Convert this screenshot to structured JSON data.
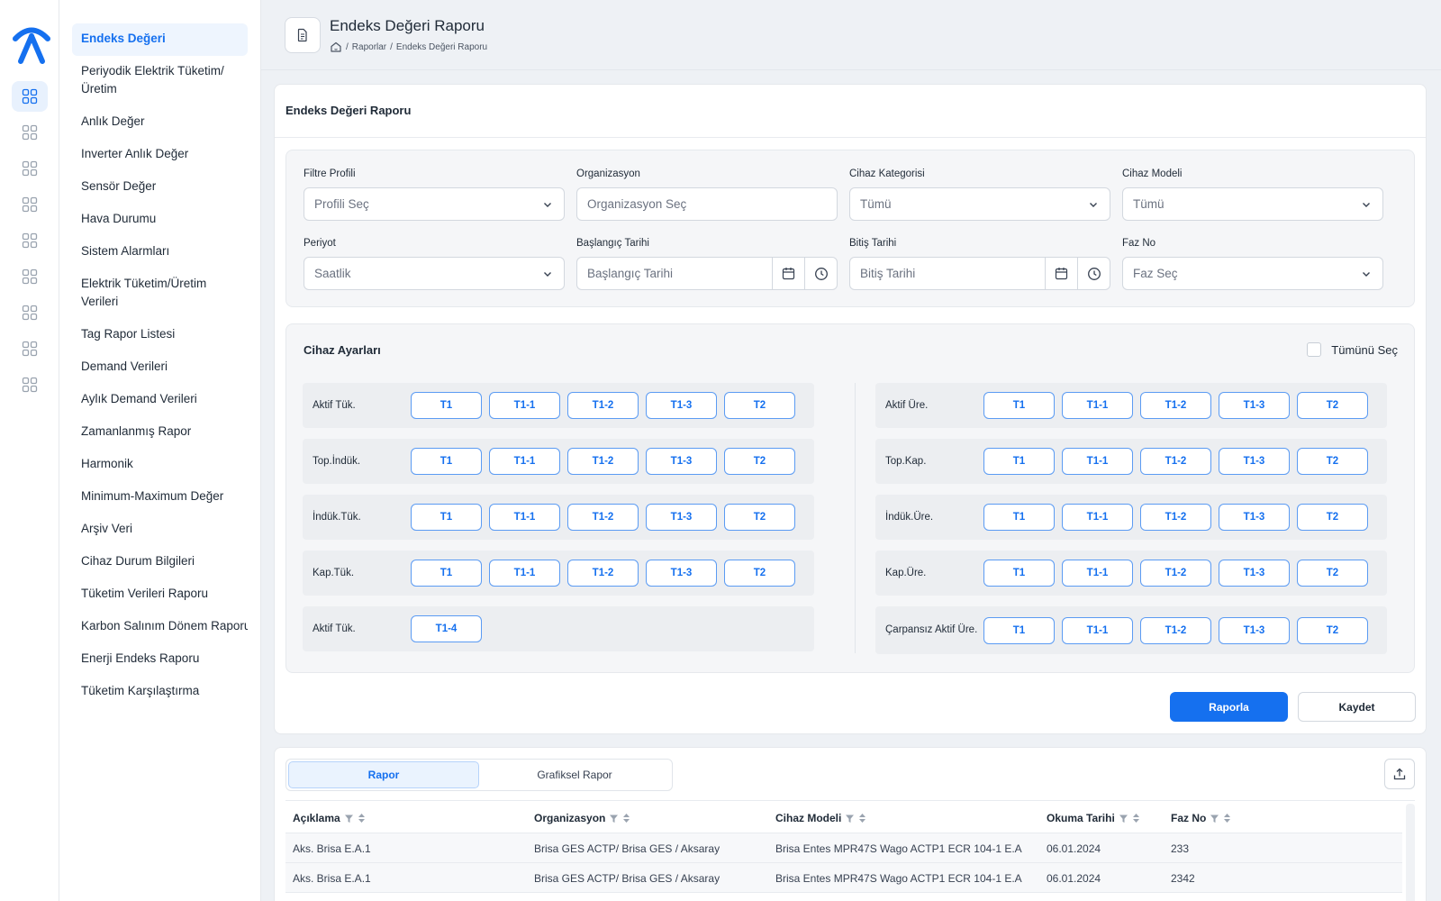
{
  "nav": {
    "items": [
      "Endeks Değeri",
      "Periyodik Elektrik Tüketim/ Üretim",
      "Anlık Değer",
      "Inverter Anlık Değer",
      "Sensör Değer",
      "Hava Durumu",
      "Sistem Alarmları",
      "Elektrik Tüketim/Üretim Verileri",
      "Tag Rapor Listesi",
      "Demand Verileri",
      "Aylık Demand Verileri",
      "Zamanlanmış Rapor",
      "Harmonik",
      "Minimum-Maximum Değer",
      "Arşiv Veri",
      "Cihaz Durum Bilgileri",
      "Tüketim Verileri Raporu",
      "Karbon Salınım Dönem Raporu",
      "Enerji Endeks Raporu",
      "Tüketim Karşılaştırma"
    ]
  },
  "header": {
    "title": "Endeks Değeri Raporu",
    "breadcrumb": [
      "Raporlar",
      "Endeks Değeri Raporu"
    ]
  },
  "form": {
    "card_title": "Endeks Değeri Raporu",
    "filtre_profili": {
      "label": "Filtre Profili",
      "value": "Profili Seç"
    },
    "organizasyon": {
      "label": "Organizasyon",
      "placeholder": "Organizasyon Seç"
    },
    "cihaz_kategorisi": {
      "label": "Cihaz Kategorisi",
      "value": "Tümü"
    },
    "cihaz_modeli": {
      "label": "Cihaz Modeli",
      "value": "Tümü"
    },
    "periyot": {
      "label": "Periyot",
      "value": "Saatlik"
    },
    "baslangic": {
      "label": "Başlangıç Tarihi",
      "placeholder": "Başlangıç Tarihi"
    },
    "bitis": {
      "label": "Bitiş Tarihi",
      "placeholder": "Bitiş Tarihi"
    },
    "faz_no": {
      "label": "Faz No",
      "value": "Faz Seç"
    }
  },
  "device_settings": {
    "title": "Cihaz Ayarları",
    "select_all": "Tümünü Seç",
    "left_rows": [
      {
        "label": "Aktif Tük.",
        "buttons": [
          "T1",
          "T1-1",
          "T1-2",
          "T1-3",
          "T2"
        ]
      },
      {
        "label": "Top.İndük.",
        "buttons": [
          "T1",
          "T1-1",
          "T1-2",
          "T1-3",
          "T2"
        ]
      },
      {
        "label": "İndük.Tük.",
        "buttons": [
          "T1",
          "T1-1",
          "T1-2",
          "T1-3",
          "T2"
        ]
      },
      {
        "label": "Kap.Tük.",
        "buttons": [
          "T1",
          "T1-1",
          "T1-2",
          "T1-3",
          "T2"
        ]
      },
      {
        "label": "Aktif Tük.",
        "buttons": [
          "T1-4"
        ]
      }
    ],
    "right_rows": [
      {
        "label": "Aktif Üre.",
        "buttons": [
          "T1",
          "T1-1",
          "T1-2",
          "T1-3",
          "T2"
        ]
      },
      {
        "label": "Top.Kap.",
        "buttons": [
          "T1",
          "T1-1",
          "T1-2",
          "T1-3",
          "T2"
        ]
      },
      {
        "label": "İndük.Üre.",
        "buttons": [
          "T1",
          "T1-1",
          "T1-2",
          "T1-3",
          "T2"
        ]
      },
      {
        "label": "Kap.Üre.",
        "buttons": [
          "T1",
          "T1-1",
          "T1-2",
          "T1-3",
          "T2"
        ]
      },
      {
        "label": "Çarpansız Aktif Üre.",
        "buttons": [
          "T1",
          "T1-1",
          "T1-2",
          "T1-3",
          "T2"
        ]
      }
    ]
  },
  "actions": {
    "report": "Raporla",
    "save": "Kaydet"
  },
  "results": {
    "tabs": [
      "Rapor",
      "Grafiksel Rapor"
    ],
    "columns": [
      "Açıklama",
      "Organizasyon",
      "Cihaz Modeli",
      "Okuma Tarihi",
      "Faz No"
    ],
    "rows": [
      [
        "Aks. Brisa E.A.1",
        "Brisa  GES ACTP/ Brisa GES / Aksaray",
        "Brisa Entes MPR47S Wago ACTP1 ECR 104-1 E.A",
        "06.01.2024",
        "233"
      ],
      [
        "Aks. Brisa E.A.1",
        "Brisa  GES ACTP/ Brisa GES / Aksaray",
        "Brisa Entes MPR47S Wago ACTP1 ECR 104-1 E.A",
        "06.01.2024",
        "2342"
      ]
    ]
  },
  "colors": {
    "accent": "#1570ef",
    "accent_light": "#eef5fe"
  }
}
